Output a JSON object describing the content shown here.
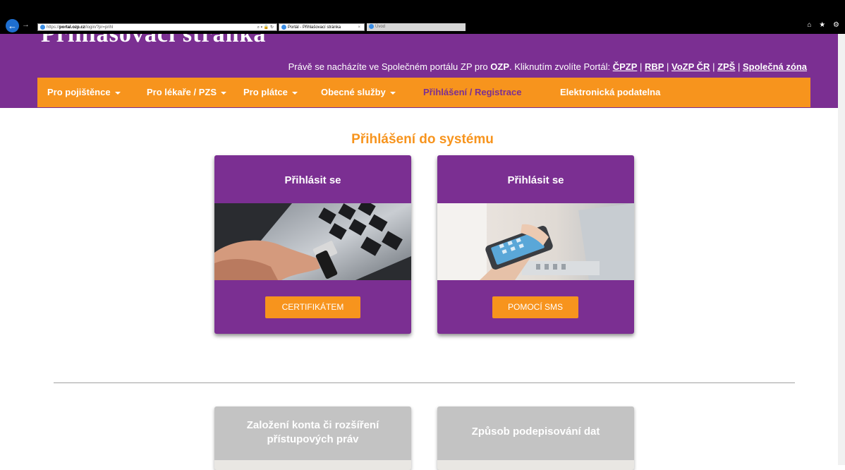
{
  "browser": {
    "url_scheme": "https://",
    "url_domain": "portal.ozp.cz",
    "url_path": "/login/?pr=prihl",
    "address_controls": "⌕ ▾ 🔒 ↻",
    "tabs": [
      {
        "label": "Portál - Přihlašovací stránka",
        "close": "×"
      },
      {
        "label": "Úvod"
      }
    ],
    "toolbar_icons": "⌂ ★ ⚙"
  },
  "header": {
    "title": "Přihlašovací stránka",
    "portal_prefix": "Právě se nacházíte ve Společném portálu ZP pro ",
    "portal_bold": "OZP",
    "portal_suffix": ". Kliknutím zvolíte Portál: ",
    "portal_links": [
      "ČPZP",
      "RBP",
      "VoZP ČR",
      "ZPŠ",
      "Společná zóna"
    ],
    "separator": " | "
  },
  "nav": {
    "items": [
      {
        "label": "Pro pojištěnce",
        "dropdown": true
      },
      {
        "label": "Pro lékaře / PZS",
        "dropdown": true
      },
      {
        "label": "Pro plátce",
        "dropdown": true
      },
      {
        "label": "Obecné služby",
        "dropdown": true
      },
      {
        "label": "Přihlášení / Registrace",
        "active": true
      },
      {
        "label": "Elektronická podatelna"
      }
    ]
  },
  "main": {
    "section_title": "Přihlášení do systému",
    "login_cards": [
      {
        "title": "Přihlásit se",
        "button": "CERTIFIKÁTEM",
        "image": "usb-token-laptop"
      },
      {
        "title": "Přihlásit se",
        "button": "POMOCÍ SMS",
        "image": "hand-with-smartphone"
      }
    ],
    "info_cards": [
      {
        "title_line1": "Založení konta či rozšíření",
        "title_line2": "přístupových práv"
      },
      {
        "title_line1": "Způsob podepisování dat"
      }
    ]
  },
  "colors": {
    "brand_purple": "#7b2f92",
    "brand_orange": "#f7941d",
    "card_grey": "#c3c3c3"
  }
}
